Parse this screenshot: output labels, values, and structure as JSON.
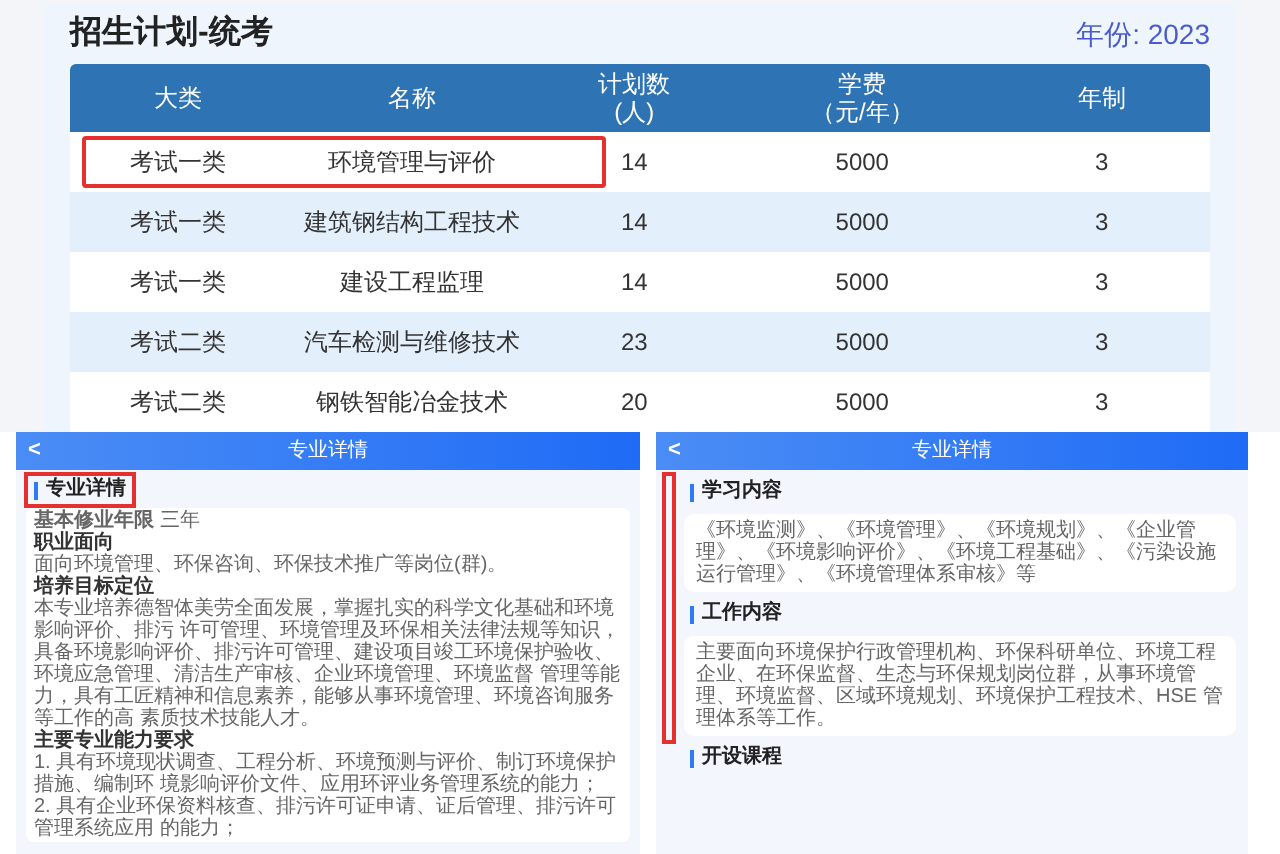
{
  "plan": {
    "title": "招生计划-统考",
    "year": "年份: 2023",
    "columns": [
      {
        "label": "大类"
      },
      {
        "label": "名称"
      },
      {
        "label": "计划数",
        "unit": "(人)"
      },
      {
        "label": "学费",
        "unit": "（元/年）"
      },
      {
        "label": "年制"
      }
    ],
    "rows": [
      {
        "cells": [
          "考试一类",
          "环境管理与评价",
          "14",
          "5000",
          "3"
        ],
        "highlighted": true
      },
      {
        "cells": [
          "考试一类",
          "建筑钢结构工程技术",
          "14",
          "5000",
          "3"
        ],
        "highlighted": false
      },
      {
        "cells": [
          "考试一类",
          "建设工程监理",
          "14",
          "5000",
          "3"
        ],
        "highlighted": false
      },
      {
        "cells": [
          "考试二类",
          "汽车检测与维修技术",
          "23",
          "5000",
          "3"
        ],
        "highlighted": false
      },
      {
        "cells": [
          "考试二类",
          "钢铁智能冶金技术",
          "20",
          "5000",
          "3"
        ],
        "highlighted": false
      }
    ]
  },
  "detail_left": {
    "back": "<",
    "title": "专业详情",
    "section": "专业详情",
    "section_highlighted": true,
    "lines": [
      {
        "kind": "mixed",
        "text": "**基本修业年限** 三年"
      },
      {
        "kind": "heading",
        "text": "职业面向"
      },
      {
        "kind": "body",
        "text": "面向环境管理、环保咨询、环保技术推广等岗位(群)。"
      },
      {
        "kind": "heading",
        "text": "培养目标定位"
      },
      {
        "kind": "body",
        "text": "本专业培养德智体美劳全面发展，掌握扎实的科学文化基础和环境影响评价、排污 许可管理、环境管理及环保相关法律法规等知识，具备环境影响评价、排污许可管理、建设项目竣工环境保护验收、环境应急管理、清洁生产审核、企业环境管理、环境监督 管理等能力，具有工匠精神和信息素养，能够从事环境管理、环境咨询服务等工作的高 素质技术技能人才。"
      },
      {
        "kind": "heading",
        "text": "主要专业能力要求"
      },
      {
        "kind": "body",
        "text": "1. 具有环境现状调查、工程分析、环境预测与评价、制订环境保护措施、编制环 境影响评价文件、应用环评业务管理系统的能力；"
      },
      {
        "kind": "body",
        "text": "2. 具有企业环保资料核查、排污许可证申请、证后管理、排污许可管理系统应用 的能力；"
      }
    ]
  },
  "detail_right": {
    "back": "<",
    "title": "专业详情",
    "annotation_box": true,
    "sections": [
      {
        "heading": "学习内容",
        "text": "《环境监测》、《环境管理》、《环境规划》、《企业管理》、《环境影响评价》、《环境工程基础》、《污染设施运行管理》、《环境管理体系审核》等"
      },
      {
        "heading": "工作内容",
        "text": "主要面向环境保护行政管理机构、环保科研单位、环境工程企业、在环保监督、生态与环保规划岗位群，从事环境管理、环境监督、区域环境规划、环境保护工程技术、HSE 管理体系等工作。"
      },
      {
        "heading": "开设课程"
      }
    ]
  }
}
